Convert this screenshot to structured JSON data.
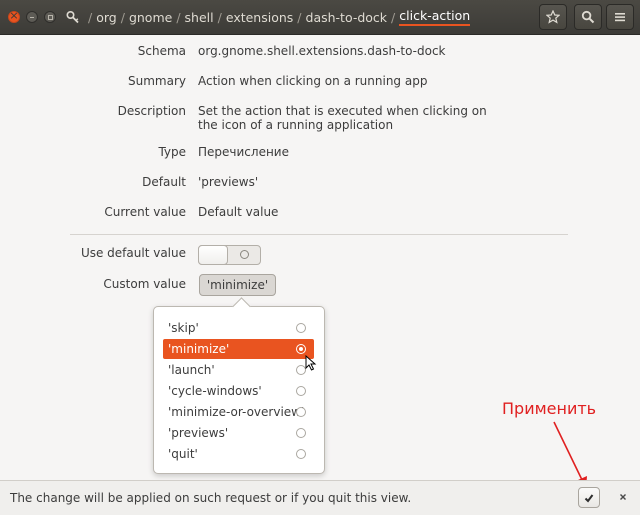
{
  "header": {
    "path": [
      "/",
      "org",
      "/",
      "gnome",
      "/",
      "shell",
      "/",
      "extensions",
      "/",
      "dash-to-dock",
      "/"
    ],
    "current_key": "click-action"
  },
  "details": {
    "schema_label": "Schema",
    "schema_value": "org.gnome.shell.extensions.dash-to-dock",
    "summary_label": "Summary",
    "summary_value": "Action when clicking on a running app",
    "description_label": "Description",
    "description_line1": "Set the action that is executed when clicking on",
    "description_line2": "the icon of a running application",
    "type_label": "Type",
    "type_value": "Перечисление",
    "default_label": "Default",
    "default_value": "'previews'",
    "current_label": "Current value",
    "current_value": "Default value"
  },
  "settings": {
    "use_default_label": "Use default value",
    "use_default_on": false,
    "custom_label": "Custom value",
    "custom_value": "'minimize'"
  },
  "popover": {
    "options": [
      "'skip'",
      "'minimize'",
      "'launch'",
      "'cycle-windows'",
      "'minimize-or-overview'",
      "'previews'",
      "'quit'"
    ],
    "selected": "'minimize'"
  },
  "annotation": {
    "text": "Применить",
    "color": "#e02020"
  },
  "infobar": {
    "message": "The change will be applied on such request or if you quit this view."
  },
  "colors": {
    "accent": "#e95420",
    "headerbar": "#3c3b37"
  }
}
